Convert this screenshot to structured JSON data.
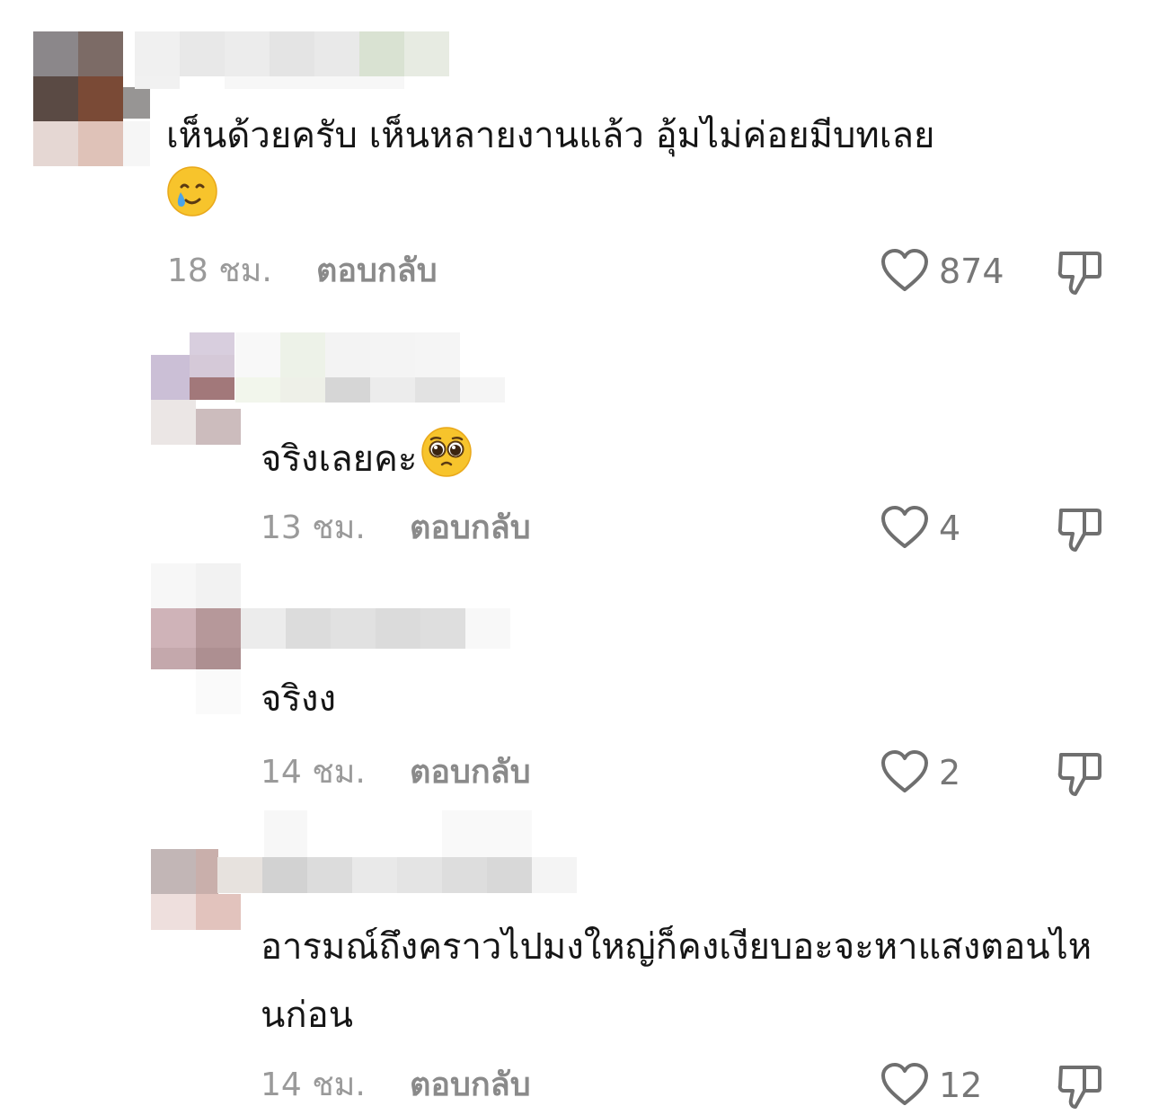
{
  "comments": [
    {
      "text": "เห็นด้วยครับ เห็นหลายงานแล้ว อุ้มไม่ค่อยมีบทเลย",
      "emoji": "smiling-face-with-tear",
      "time": "18 ชม.",
      "reply_label": "ตอบกลับ",
      "likes": "874"
    },
    {
      "text": "จริงเลยคะ",
      "emoji": "pleading-face",
      "time": "13 ชม.",
      "reply_label": "ตอบกลับ",
      "likes": "4"
    },
    {
      "text": "จริงง",
      "time": "14 ชม.",
      "reply_label": "ตอบกลับ",
      "likes": "2"
    },
    {
      "text": "อารมณ์ถึงคราวไปมงใหญ่ก็คงเงียบอะจะหาแสงตอนไหนก่อน",
      "time": "14 ชม.",
      "reply_label": "ตอบกลับ",
      "likes": "12"
    }
  ],
  "colors": {
    "text": "#161616",
    "meta": "#9a9a9a",
    "reply": "#8a8a8a",
    "icon": "#6f6f6f"
  }
}
